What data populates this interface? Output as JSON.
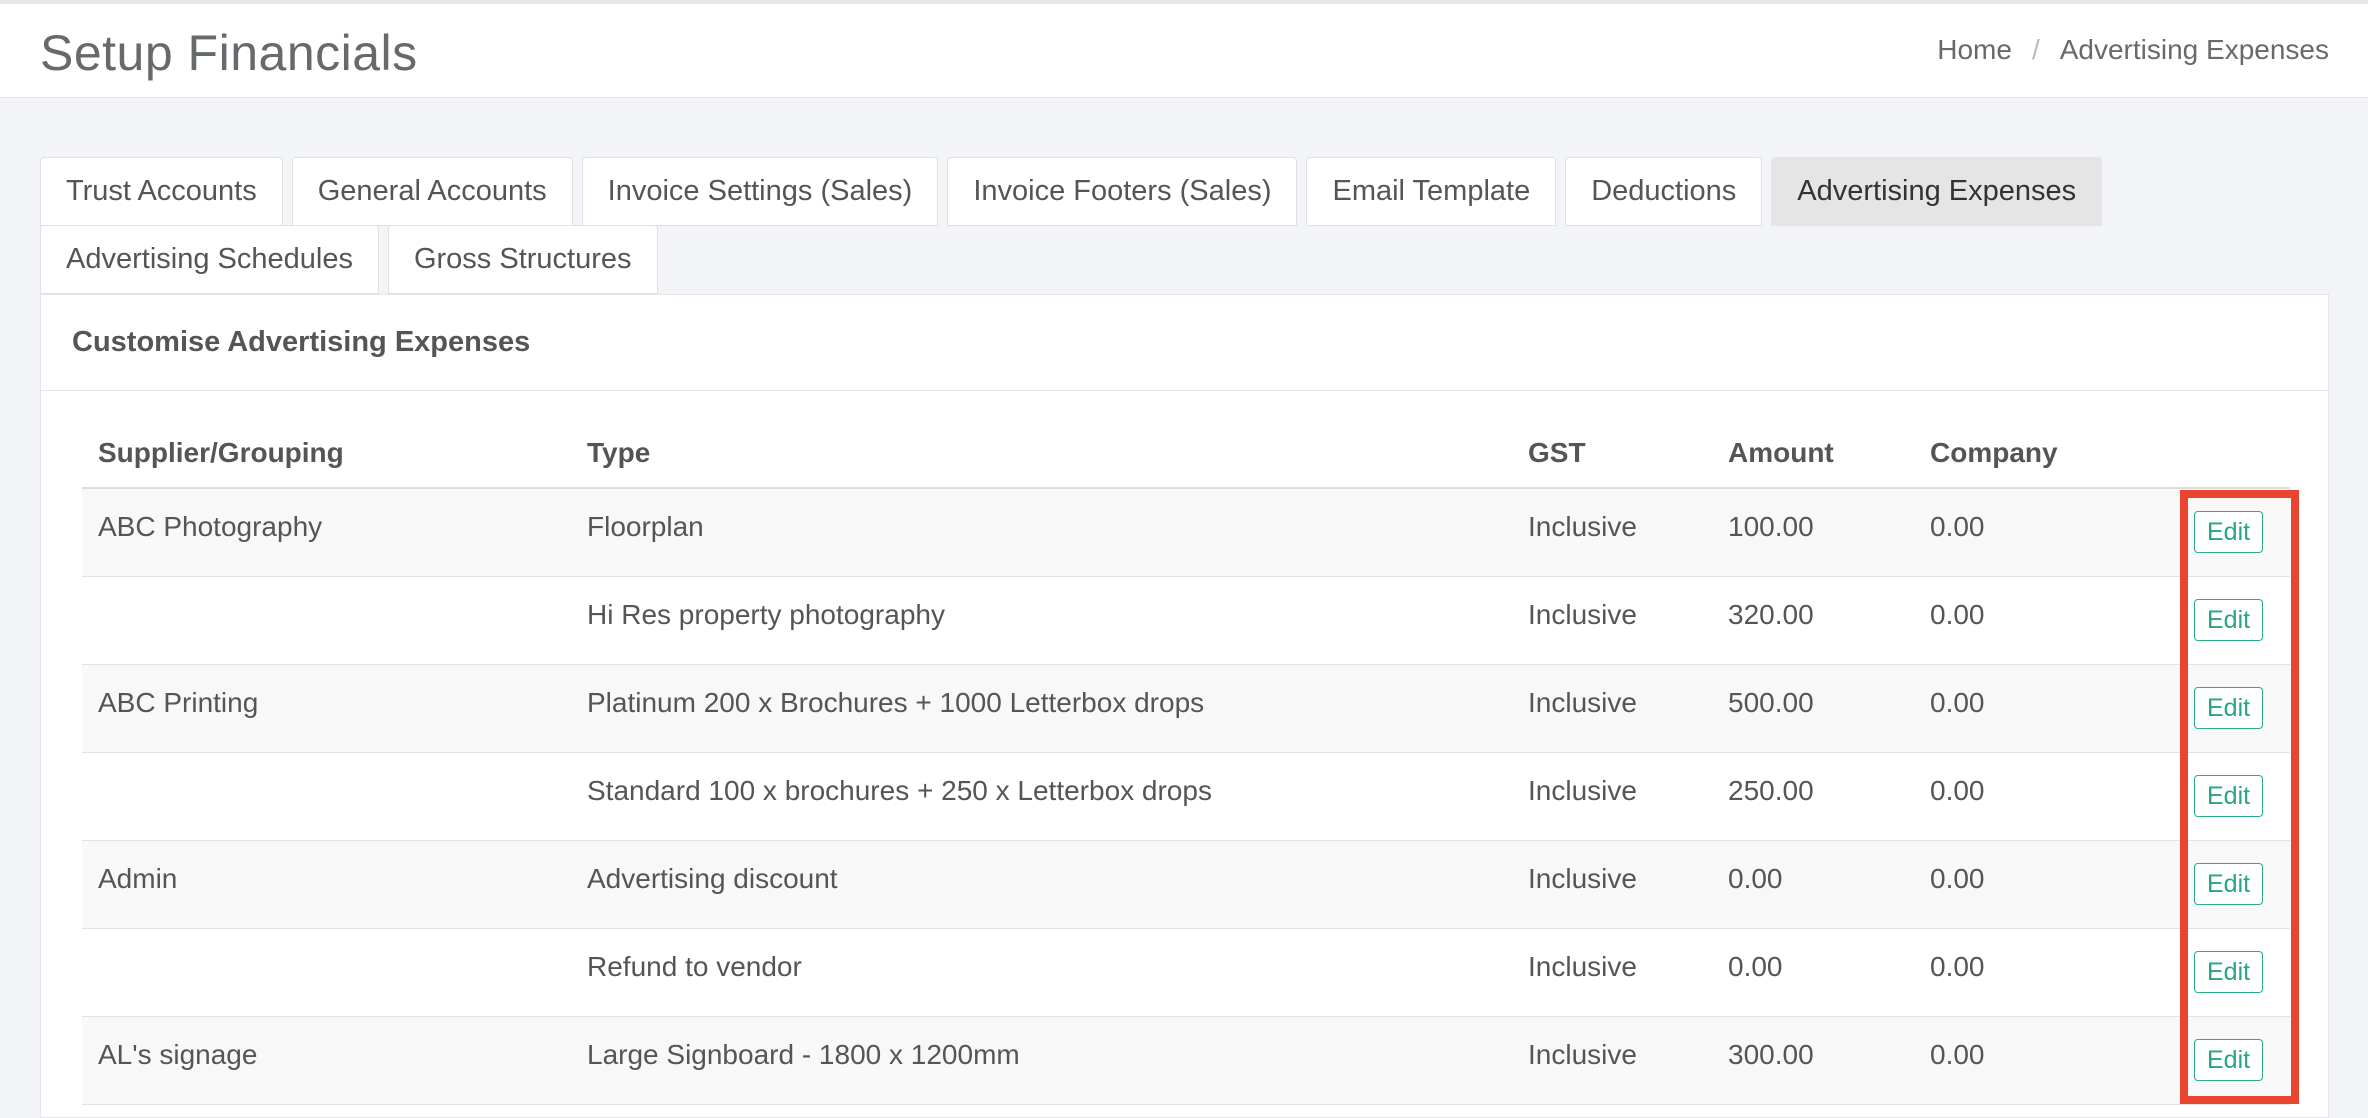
{
  "page": {
    "title": "Setup Financials",
    "breadcrumb": {
      "home": "Home",
      "separator": "/",
      "current": "Advertising Expenses"
    }
  },
  "tabs": {
    "row1": [
      "Trust Accounts",
      "General Accounts",
      "Invoice Settings (Sales)",
      "Invoice Footers (Sales)",
      "Email Template",
      "Deductions",
      "Advertising Expenses"
    ],
    "row2": [
      "Advertising Schedules",
      "Gross Structures"
    ],
    "active": "Advertising Expenses"
  },
  "panel": {
    "heading": "Customise Advertising Expenses",
    "columns": [
      "Supplier/Grouping",
      "Type",
      "GST",
      "Amount",
      "Company",
      ""
    ],
    "rows": [
      {
        "supplier": "ABC Photography",
        "type": "Floorplan",
        "gst": "Inclusive",
        "amount": "100.00",
        "company": "0.00",
        "action": "Edit"
      },
      {
        "supplier": "",
        "type": "Hi Res property photography",
        "gst": "Inclusive",
        "amount": "320.00",
        "company": "0.00",
        "action": "Edit"
      },
      {
        "supplier": "ABC Printing",
        "type": "Platinum 200 x Brochures + 1000 Letterbox drops",
        "gst": "Inclusive",
        "amount": "500.00",
        "company": "0.00",
        "action": "Edit"
      },
      {
        "supplier": "",
        "type": "Standard 100 x brochures + 250 x Letterbox drops",
        "gst": "Inclusive",
        "amount": "250.00",
        "company": "0.00",
        "action": "Edit"
      },
      {
        "supplier": "Admin",
        "type": "Advertising discount",
        "gst": "Inclusive",
        "amount": "0.00",
        "company": "0.00",
        "action": "Edit"
      },
      {
        "supplier": "",
        "type": "Refund to vendor",
        "gst": "Inclusive",
        "amount": "0.00",
        "company": "0.00",
        "action": "Edit"
      },
      {
        "supplier": "AL's signage",
        "type": "Large Signboard - 1800 x 1200mm",
        "gst": "Inclusive",
        "amount": "300.00",
        "company": "0.00",
        "action": "Edit"
      }
    ]
  },
  "colors": {
    "accent_green": "#27a584",
    "highlight_red": "#e8442e",
    "active_tab_bg": "#e5e5e5",
    "page_bg": "#f3f4f7"
  }
}
